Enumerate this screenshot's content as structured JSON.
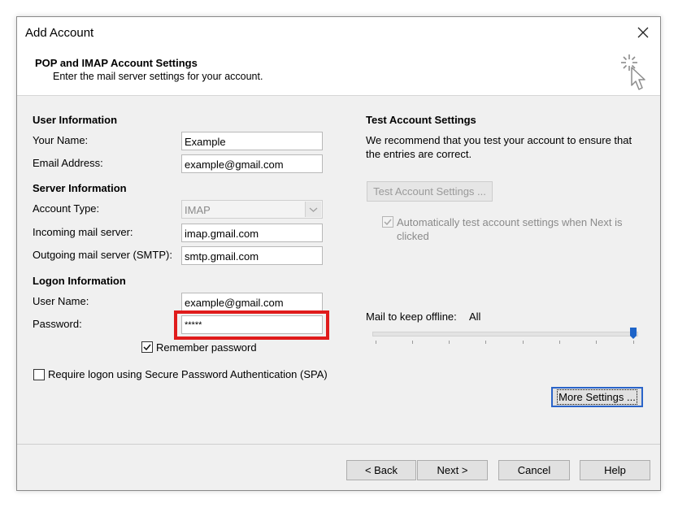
{
  "window": {
    "title": "Add Account"
  },
  "header": {
    "title": "POP and IMAP Account Settings",
    "subtitle": "Enter the mail server settings for your account."
  },
  "user_info": {
    "heading": "User Information",
    "name_label": "Your Name:",
    "name_value": "Example",
    "email_label": "Email Address:",
    "email_value": "example@gmail.com"
  },
  "server_info": {
    "heading": "Server Information",
    "account_type_label": "Account Type:",
    "account_type_value": "IMAP",
    "incoming_label": "Incoming mail server:",
    "incoming_value": "imap.gmail.com",
    "outgoing_label": "Outgoing mail server (SMTP):",
    "outgoing_value": "smtp.gmail.com"
  },
  "logon_info": {
    "heading": "Logon Information",
    "username_label": "User Name:",
    "username_value": "example@gmail.com",
    "password_label": "Password:",
    "password_value": "*****",
    "remember_label": "Remember password",
    "remember_checked": true,
    "spa_label": "Require logon using Secure Password Authentication (SPA)",
    "spa_checked": false
  },
  "test": {
    "heading": "Test Account Settings",
    "description": "We recommend that you test your account to ensure that the entries are correct.",
    "button_label": "Test Account Settings ...",
    "auto_test_label": "Automatically test account settings when Next is clicked",
    "auto_test_checked": true
  },
  "offline": {
    "label": "Mail to keep offline:",
    "value": "All",
    "slider_fraction": 1.0
  },
  "buttons": {
    "more_settings": "More Settings ...",
    "back": "< Back",
    "next": "Next >",
    "cancel": "Cancel",
    "help": "Help"
  },
  "colors": {
    "highlight": "#e01b1b",
    "focus": "#2a64c9",
    "slider_thumb": "#1e64c8"
  },
  "icons": {
    "close": "close-icon",
    "wizard": "cursor-sparkle-icon",
    "dropdown": "chevron-down-icon",
    "check": "check-icon"
  }
}
